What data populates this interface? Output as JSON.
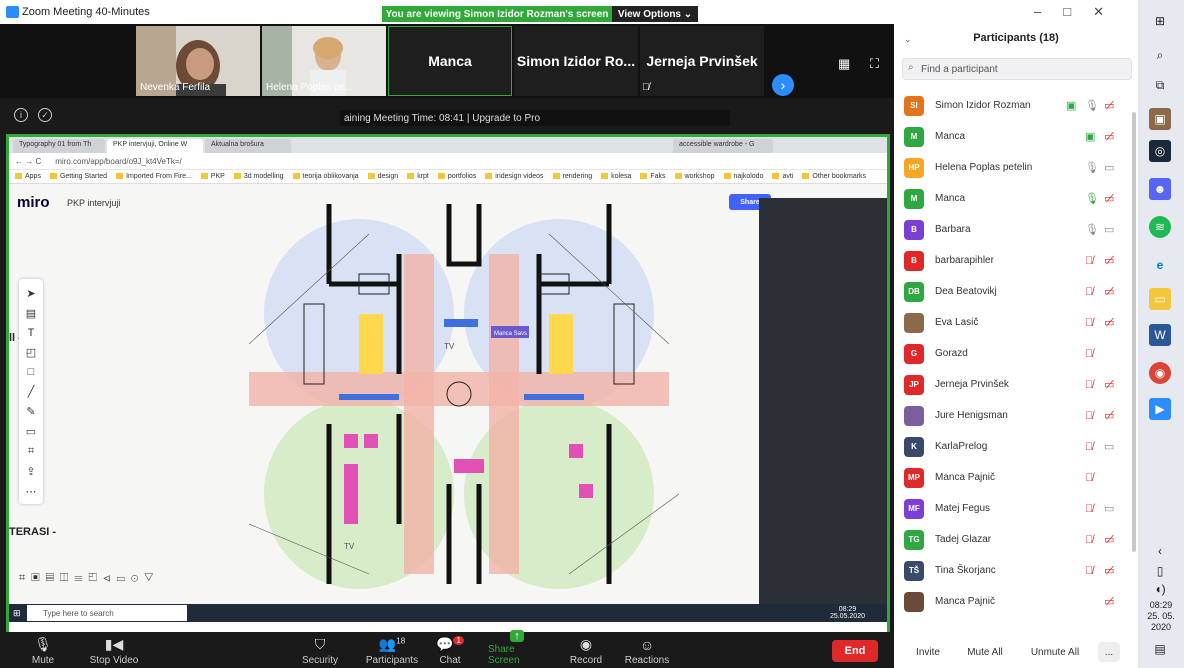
{
  "window": {
    "title": "Zoom Meeting 40-Minutes"
  },
  "banner": {
    "viewing": "You are viewing Simon Izidor Rozman's screen",
    "view_options": "View Options ⌄"
  },
  "strip": {
    "tiles": [
      {
        "name": "Nevenka Ferfila"
      },
      {
        "name": "Helena Poplas pe..."
      },
      {
        "name": "Manca"
      },
      {
        "name": "Simon Izidor Ro..."
      },
      {
        "name": "Jerneja Prvinšek"
      }
    ]
  },
  "timer": "aining Meeting Time: 08:41 | Upgrade to Pro",
  "browser": {
    "tabs": [
      "Typography 01 from Th",
      "PKP intervjuji, Online W",
      "Aktualna brošura",
      "accessible wardrobe - G"
    ],
    "url": "miro.com/app/board/o9J_kt4VeTk=/",
    "bookmarks": [
      "Apps",
      "Getting Started",
      "Imported From Fire...",
      "PKP",
      "3d modelling",
      "teorija oblikovanja",
      "design",
      "krpt",
      "portfolios",
      "indesign videos",
      "rendering",
      "kolesa",
      "Faks",
      "workshop",
      "najkolodo",
      "avti",
      "Other bookmarks"
    ]
  },
  "miro": {
    "logo": "miro",
    "board": "PKP intervjuji",
    "share": "Share",
    "label_ll": "ll -",
    "label_terasi": "TERASI -",
    "cursor_label": "Manca Savs",
    "tv1": "TV",
    "tv2": "TV"
  },
  "taskbar_inner": {
    "search": "Type here to search",
    "time": "08:29",
    "date": "25.05.2020"
  },
  "controls": {
    "mute": "Mute",
    "stop_video": "Stop Video",
    "security": "Security",
    "participants": "Participants",
    "participants_count": "18",
    "chat": "Chat",
    "chat_badge": "1",
    "share_screen": "Share Screen",
    "record": "Record",
    "reactions": "Reactions",
    "end": "End"
  },
  "panel": {
    "title": "Participants (18)",
    "search_placeholder": "Find a participant",
    "participants": [
      {
        "initials": "SI",
        "name": "Simon Izidor Rozman",
        "color": "#e5731a",
        "mic": "on",
        "cam": "off",
        "sharing": true
      },
      {
        "initials": "M",
        "name": "Manca",
        "color": "#2fa742",
        "mic": "none",
        "cam": "off",
        "sharing": true
      },
      {
        "initials": "HP",
        "name": "Helena Poplas petelin",
        "color": "#f5a623",
        "mic": "on",
        "cam": "on"
      },
      {
        "initials": "M",
        "name": "Manca",
        "color": "#2fa742",
        "mic": "speaking",
        "cam": "off"
      },
      {
        "initials": "B",
        "name": "Barbara",
        "color": "#7b3fd6",
        "mic": "on",
        "cam": "on"
      },
      {
        "initials": "B",
        "name": "barbarapihler",
        "color": "#e02828",
        "mic": "off",
        "cam": "off"
      },
      {
        "initials": "DB",
        "name": "Dea Beatovikj",
        "color": "#2fa742",
        "mic": "off",
        "cam": "off"
      },
      {
        "initials": "",
        "name": "Eva Lasič",
        "color": "#8a6a4a",
        "mic": "off",
        "cam": "off"
      },
      {
        "initials": "G",
        "name": "Gorazd",
        "color": "#e02828",
        "mic": "off",
        "cam": "none"
      },
      {
        "initials": "JP",
        "name": "Jerneja Prvinšek",
        "color": "#e02828",
        "mic": "off",
        "cam": "off"
      },
      {
        "initials": "",
        "name": "Jure Henigsman",
        "color": "#7a5fa0",
        "mic": "off",
        "cam": "off"
      },
      {
        "initials": "K",
        "name": "KarlaPrelog",
        "color": "#3a4a6a",
        "mic": "off",
        "cam": "on"
      },
      {
        "initials": "MP",
        "name": "Manca Pajnič",
        "color": "#e02828",
        "mic": "off",
        "cam": "none"
      },
      {
        "initials": "MF",
        "name": "Matej Fegus",
        "color": "#7b3fd6",
        "mic": "off",
        "cam": "on"
      },
      {
        "initials": "TG",
        "name": "Tadej Glazar",
        "color": "#2fa742",
        "mic": "off",
        "cam": "off"
      },
      {
        "initials": "TŠ",
        "name": "Tina Škorjanc",
        "color": "#3a4a6a",
        "mic": "off",
        "cam": "off"
      },
      {
        "initials": "",
        "name": "Manca Pajnič",
        "color": "#6a4a3a",
        "mic": "none",
        "cam": "off"
      }
    ],
    "invite": "Invite",
    "mute_all": "Mute All",
    "unmute_all": "Unmute All",
    "more": "..."
  },
  "system": {
    "time": "08:29",
    "date": "25. 05. 2020"
  }
}
